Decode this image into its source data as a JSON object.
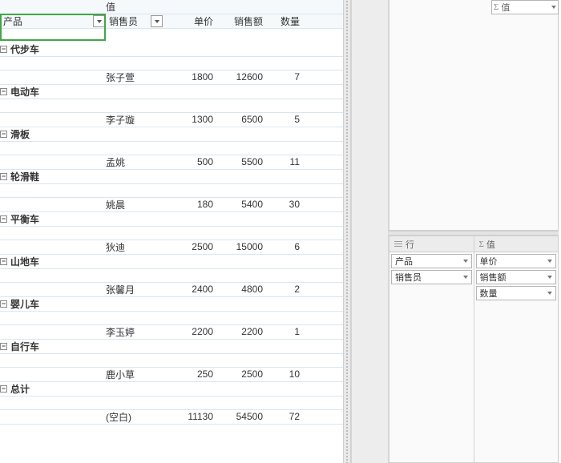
{
  "pivot": {
    "values_header": "值",
    "columns": {
      "product": "产品",
      "salesperson": "销售员",
      "price": "单价",
      "amount": "销售额",
      "qty": "数量"
    },
    "groups": [
      {
        "label": "代步车",
        "salesperson": "张子萱",
        "price": 1800,
        "amount": 12600,
        "qty": 7
      },
      {
        "label": "电动车",
        "salesperson": "李子璇",
        "price": 1300,
        "amount": 6500,
        "qty": 5
      },
      {
        "label": "滑板",
        "salesperson": "孟姚",
        "price": 500,
        "amount": 5500,
        "qty": 11
      },
      {
        "label": "轮滑鞋",
        "salesperson": "姚晨",
        "price": 180,
        "amount": 5400,
        "qty": 30
      },
      {
        "label": "平衡车",
        "salesperson": "狄迪",
        "price": 2500,
        "amount": 15000,
        "qty": 6
      },
      {
        "label": "山地车",
        "salesperson": "张馨月",
        "price": 2400,
        "amount": 4800,
        "qty": 2
      },
      {
        "label": "婴儿车",
        "salesperson": "李玉婷",
        "price": 2200,
        "amount": 2200,
        "qty": 1
      },
      {
        "label": "自行车",
        "salesperson": "鹿小草",
        "price": 250,
        "amount": 2500,
        "qty": 10
      }
    ],
    "total_label": "总计",
    "blank_label": "(空白)",
    "totals": {
      "price": 11130,
      "amount": 54500,
      "qty": 72
    }
  },
  "field_list": {
    "filter_label": "Σ值",
    "areas": {
      "rows_header": "行",
      "values_header": "值",
      "rows": [
        "产品",
        "销售员"
      ],
      "values": [
        "单价",
        "销售额",
        "数量"
      ]
    }
  }
}
